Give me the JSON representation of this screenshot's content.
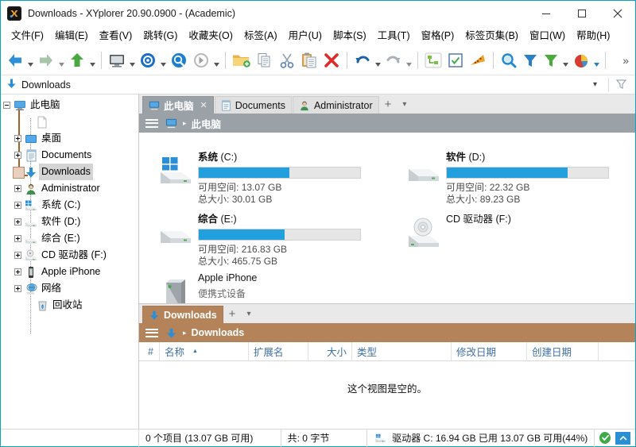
{
  "window": {
    "title": "Downloads - XYplorer 20.90.0900 - (Academic)",
    "minimize_label": "─",
    "maximize_label": "□",
    "close_label": "✕"
  },
  "menubar": {
    "items": [
      {
        "label": "文件(F)"
      },
      {
        "label": "编辑(E)"
      },
      {
        "label": "查看(V)"
      },
      {
        "label": "跳转(G)"
      },
      {
        "label": "收藏夹(O)"
      },
      {
        "label": "标签(A)"
      },
      {
        "label": "用户(U)"
      },
      {
        "label": "脚本(S)"
      },
      {
        "label": "工具(T)"
      },
      {
        "label": "窗格(P)"
      },
      {
        "label": "标签页集(B)"
      },
      {
        "label": "窗口(W)"
      },
      {
        "label": "帮助(H)"
      }
    ]
  },
  "toolbar": {
    "overflow_label": "»",
    "buttons": [
      {
        "name": "back-icon",
        "tip": "后退"
      },
      {
        "name": "forward-icon",
        "tip": "前进"
      },
      {
        "name": "up-icon",
        "tip": "向上"
      },
      {
        "name": "computer-icon",
        "tip": "此电脑"
      },
      {
        "name": "target-icon",
        "tip": "目标"
      },
      {
        "name": "search-icon",
        "tip": "搜索"
      },
      {
        "name": "go-icon",
        "tip": "转到"
      },
      {
        "name": "new-folder-icon",
        "tip": "新建文件夹"
      },
      {
        "name": "copy-icon",
        "tip": "复制"
      },
      {
        "name": "cut-icon",
        "tip": "剪切"
      },
      {
        "name": "paste-icon",
        "tip": "粘贴"
      },
      {
        "name": "delete-icon",
        "tip": "删除"
      },
      {
        "name": "undo-icon",
        "tip": "撤销"
      },
      {
        "name": "redo-icon",
        "tip": "重做"
      },
      {
        "name": "tree-sync-icon",
        "tip": "同步目录树"
      },
      {
        "name": "checkbox-select-icon",
        "tip": "选择框"
      },
      {
        "name": "color-filter-icon",
        "tip": "颜色筛选"
      },
      {
        "name": "find-files-icon",
        "tip": "查找文件"
      },
      {
        "name": "filter-blue-icon",
        "tip": "筛选"
      },
      {
        "name": "filter-green-icon",
        "tip": "快速筛选"
      },
      {
        "name": "disk-report-icon",
        "tip": "磁盘报告"
      }
    ]
  },
  "addressbar": {
    "icon": "downloads-icon",
    "path": "Downloads"
  },
  "tree": {
    "nodes": [
      {
        "label": "此电脑",
        "icon": "computer-icon",
        "depth": 0,
        "expander": "minus",
        "selected": false
      },
      {
        "label": "",
        "icon": "file-icon",
        "depth": 2,
        "expander": "none",
        "selected": false
      },
      {
        "label": "桌面",
        "icon": "desktop-icon",
        "depth": 1,
        "expander": "plus",
        "selected": false
      },
      {
        "label": "Documents",
        "icon": "documents-icon",
        "depth": 1,
        "expander": "plus",
        "selected": false
      },
      {
        "label": "Downloads",
        "icon": "downloads-icon",
        "depth": 1,
        "expander": "none",
        "selected": true
      },
      {
        "label": "Administrator",
        "icon": "user-icon",
        "depth": 1,
        "expander": "plus",
        "selected": false
      },
      {
        "label": "系统 (C:)",
        "icon": "windows-drive-icon",
        "depth": 1,
        "expander": "plus",
        "selected": false
      },
      {
        "label": "软件 (D:)",
        "icon": "drive-icon",
        "depth": 1,
        "expander": "plus",
        "selected": false
      },
      {
        "label": "综合 (E:)",
        "icon": "drive-icon",
        "depth": 1,
        "expander": "plus",
        "selected": false
      },
      {
        "label": "CD 驱动器 (F:)",
        "icon": "cd-drive-icon",
        "depth": 1,
        "expander": "plus",
        "selected": false
      },
      {
        "label": "Apple iPhone",
        "icon": "phone-icon",
        "depth": 1,
        "expander": "plus",
        "selected": false
      },
      {
        "label": "网络",
        "icon": "network-icon",
        "depth": 1,
        "expander": "plus",
        "selected": false
      },
      {
        "label": "回收站",
        "icon": "recycle-bin-icon",
        "depth": 2,
        "expander": "none",
        "selected": false
      }
    ]
  },
  "top_pane": {
    "tabs": [
      {
        "label": "此电脑",
        "icon": "computer-icon",
        "active": true,
        "closable": true
      },
      {
        "label": "Documents",
        "icon": "documents-icon",
        "active": false,
        "closable": false
      },
      {
        "label": "Administrator",
        "icon": "user-icon",
        "active": false,
        "closable": false
      }
    ],
    "add_tab_label": "+",
    "tab_menu_label": "▾",
    "breadcrumb": "此电脑",
    "breadcrumb_icon": "computer-icon",
    "breadcrumb_arrow": "▸",
    "drives": [
      {
        "name_bold": "系统",
        "name_rest": " (C:)",
        "icon": "windows-drive-icon",
        "used_percent": 56,
        "free_label": "可用空间:",
        "free_value": "13.07 GB",
        "total_label": "总大小:",
        "total_value": "30.01 GB",
        "has_bar": true
      },
      {
        "name_bold": "软件",
        "name_rest": " (D:)",
        "icon": "drive-icon",
        "used_percent": 75,
        "free_label": "可用空间:",
        "free_value": "22.32 GB",
        "total_label": "总大小:",
        "total_value": "89.23 GB",
        "has_bar": true
      },
      {
        "name_bold": "综合",
        "name_rest": " (E:)",
        "icon": "drive-icon",
        "used_percent": 53,
        "free_label": "可用空间:",
        "free_value": "216.83 GB",
        "total_label": "总大小:",
        "total_value": "465.75 GB",
        "has_bar": true
      },
      {
        "name_bold": "",
        "name_rest": "CD 驱动器 (F:)",
        "icon": "cd-drive-icon",
        "has_bar": false,
        "free_label": "",
        "free_value": "",
        "total_label": "",
        "total_value": ""
      },
      {
        "name_bold": "",
        "name_rest": "Apple iPhone",
        "icon": "phone-device-icon",
        "has_bar": false,
        "subtitle": "便携式设备",
        "free_label": "",
        "free_value": "",
        "total_label": "",
        "total_value": ""
      }
    ]
  },
  "bottom_pane": {
    "tabs": [
      {
        "label": "Downloads",
        "icon": "downloads-icon",
        "active": true
      }
    ],
    "add_tab_label": "+",
    "tab_menu_label": "▾",
    "breadcrumb": "Downloads",
    "breadcrumb_icon": "downloads-icon",
    "breadcrumb_arrow": "▸",
    "columns": [
      {
        "label": "#",
        "sorted": false
      },
      {
        "label": "名称",
        "sorted": true
      },
      {
        "label": "扩展名",
        "sorted": false
      },
      {
        "label": "大小",
        "sorted": false
      },
      {
        "label": "类型",
        "sorted": false
      },
      {
        "label": "修改日期",
        "sorted": false
      },
      {
        "label": "创建日期",
        "sorted": false
      }
    ],
    "empty_message": "这个视图是空的。"
  },
  "statusbar": {
    "items_text": "0 个项目 (13.07 GB 可用)",
    "total_text": "共: 0 字节",
    "drive_icon": "drive-icon",
    "drive_text": "驱动器 C: 16.94 GB 已用   13.07 GB 可用(44%)",
    "ok_icon": "check-icon",
    "scroll_up_icon": "chevron-up-icon"
  },
  "colors": {
    "accent_blue": "#22a0de",
    "tab_active_gray": "#9aa2a8",
    "tab_active_brown": "#b5835a",
    "title_border": "#0aa3c2",
    "column_header_text": "#3f6fa5"
  }
}
